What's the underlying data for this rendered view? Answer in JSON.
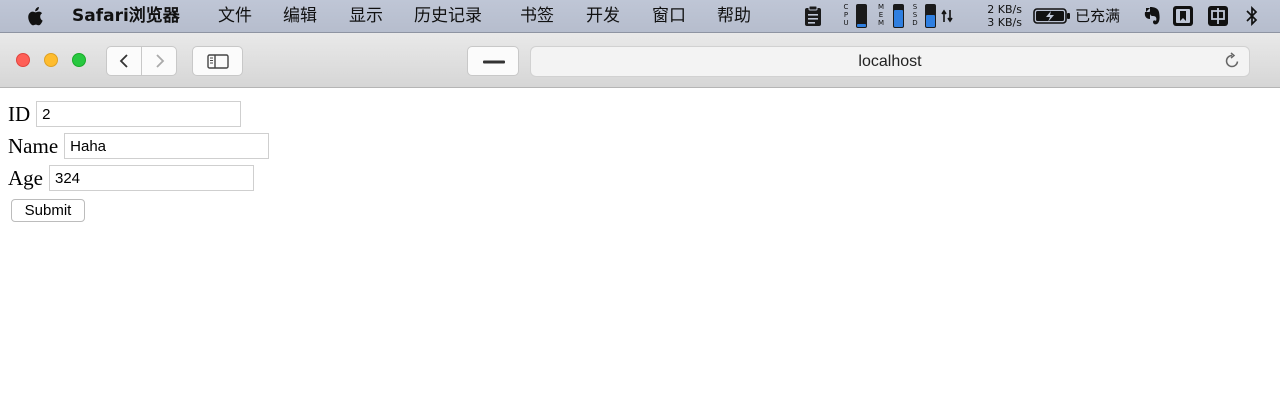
{
  "menubar": {
    "app_name": "Safari浏览器",
    "items": [
      "文件",
      "编辑",
      "显示",
      "历史记录",
      "书签",
      "开发",
      "窗口",
      "帮助"
    ],
    "net_up": "2 KB/s",
    "net_down": "3 KB/s",
    "battery_status": "已充满",
    "cpu_label": "CPU",
    "mem_label": "MEM",
    "ssd_label": "SSD"
  },
  "browser": {
    "address": "localhost"
  },
  "form": {
    "id_label": "ID",
    "id_value": "2",
    "name_label": "Name",
    "name_value": "Haha",
    "age_label": "Age",
    "age_value": "324",
    "submit_label": "Submit"
  },
  "colors": {
    "close": "#fe5f57",
    "minimize": "#febc2e",
    "zoom": "#28c840",
    "meter_blue": "#2f7fe0"
  }
}
